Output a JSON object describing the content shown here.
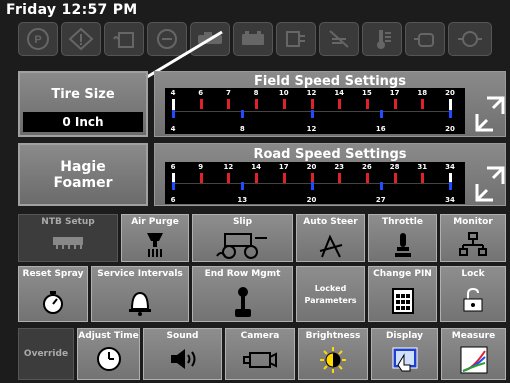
{
  "status": {
    "clock": "Friday 12:57 PM"
  },
  "warning_icons": [
    "parking-brake-icon",
    "warning-triangle-icon",
    "hydraulic-oil-icon",
    "engine-oil-icon",
    "transmission-icon",
    "battery-icon",
    "fuel-filter-icon",
    "air-filter-icon",
    "coolant-temp-icon",
    "engine-icon",
    "engine-warning-icon"
  ],
  "tire": {
    "label": "Tire Size",
    "value": "0 Inch"
  },
  "field_speed": {
    "title": "Field Speed Settings",
    "top_labels": [
      "4",
      "6",
      "7",
      "8",
      "10",
      "12",
      "14",
      "15",
      "17",
      "18",
      "20"
    ],
    "bottom_labels": [
      "4",
      "8",
      "12",
      "16",
      "20"
    ]
  },
  "machine": {
    "label_line1": "Hagie",
    "label_line2": "Foamer"
  },
  "road_speed": {
    "title": "Road Speed Settings",
    "top_labels": [
      "6",
      "9",
      "12",
      "14",
      "17",
      "20",
      "23",
      "26",
      "28",
      "31",
      "34"
    ],
    "bottom_labels": [
      "6",
      "13",
      "20",
      "27",
      "34"
    ]
  },
  "grid": {
    "row1": [
      "NTB Setup",
      "Air Purge",
      "Slip",
      "Auto Steer",
      "Throttle",
      "Monitor"
    ],
    "row2": [
      "Reset Spray",
      "Service Intervals",
      "End Row Mgmt",
      "Locked Parameters",
      "Change PIN",
      "Lock"
    ],
    "row3": [
      "Override",
      "Adjust Time",
      "Sound",
      "Camera",
      "Brightness",
      "Display",
      "Measure"
    ]
  },
  "colors": {
    "red_tick": "#e0202a",
    "blue_tick": "#1e4cff",
    "white_tick": "#ffffff",
    "accent_arrow": "#ffffff"
  }
}
